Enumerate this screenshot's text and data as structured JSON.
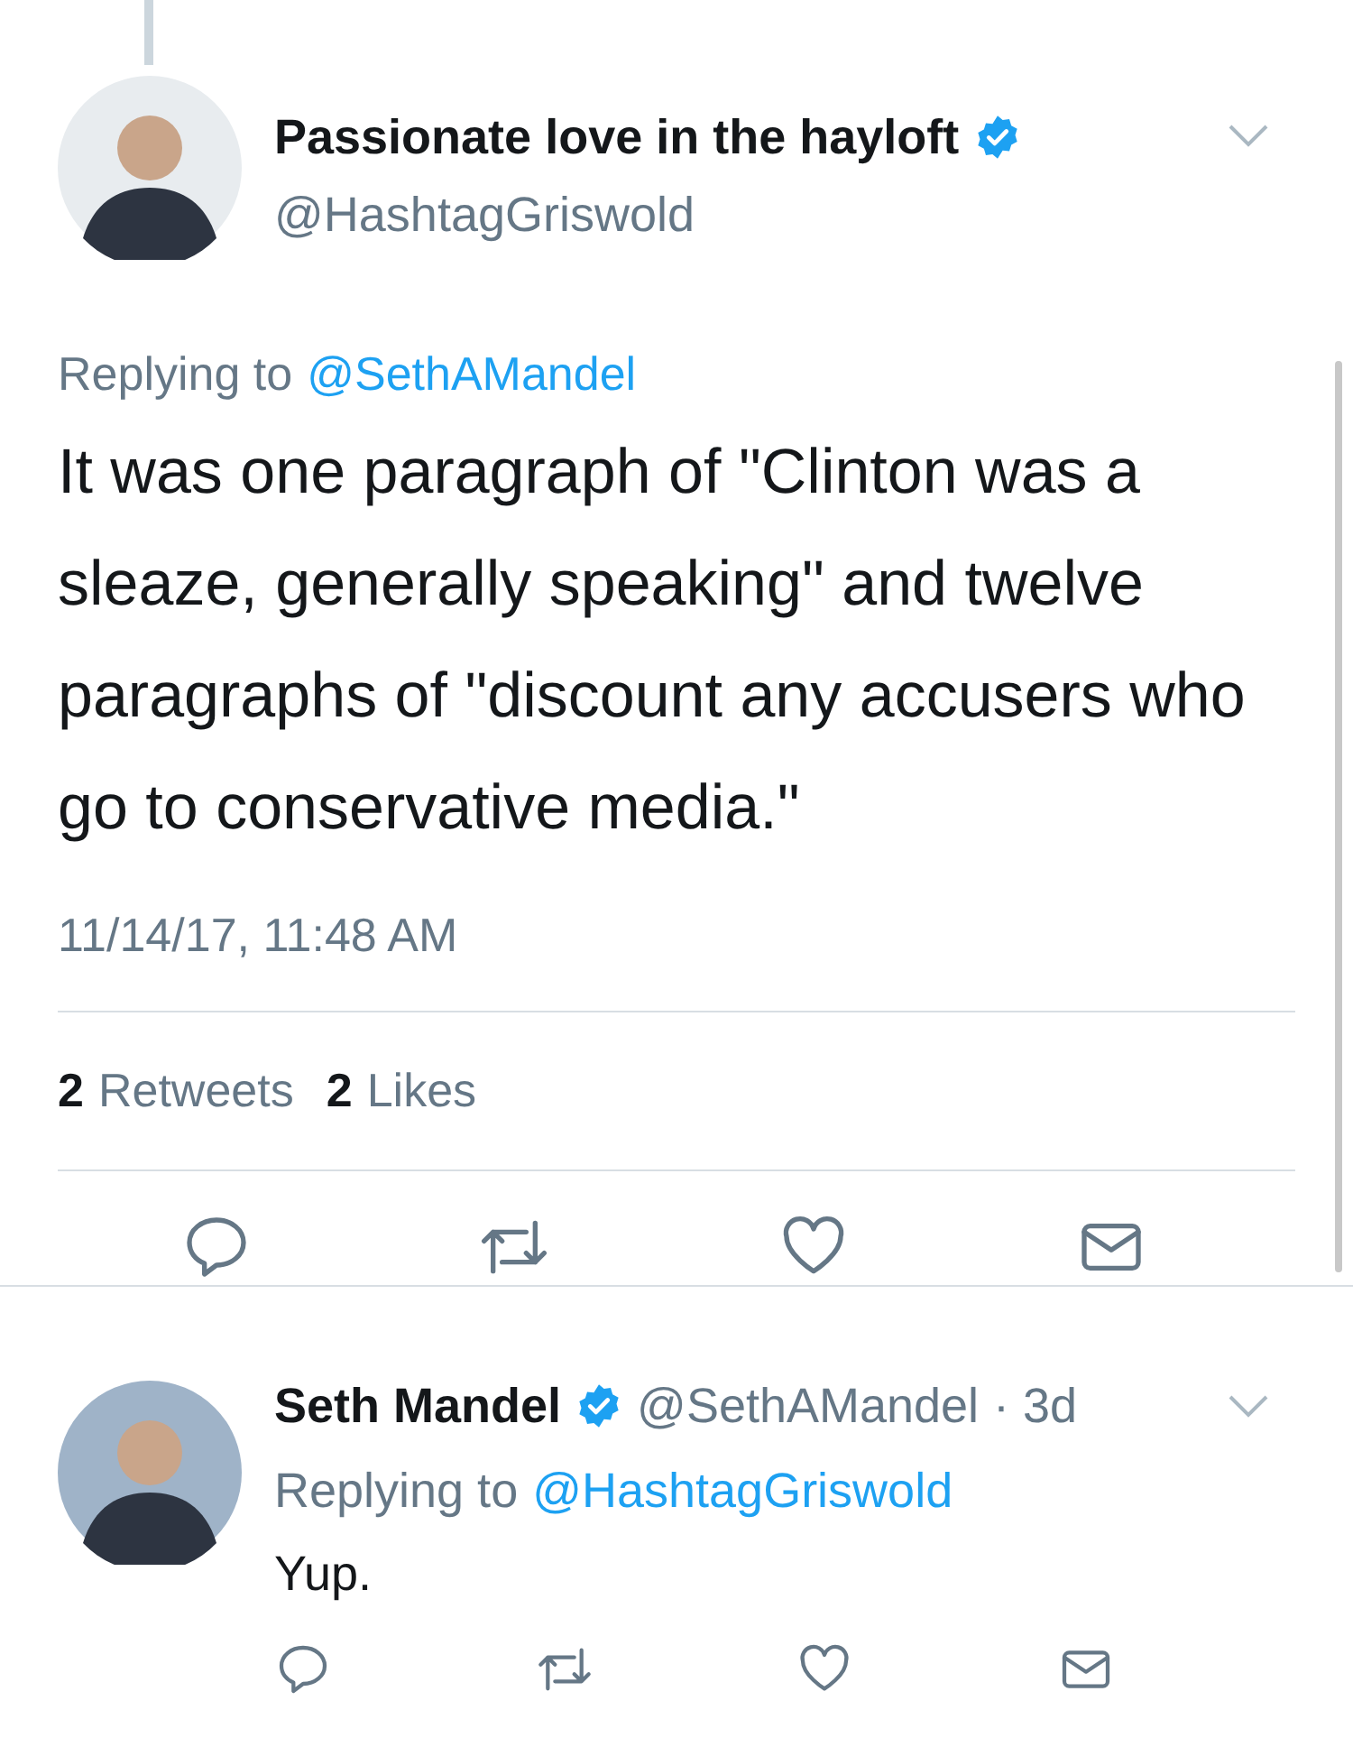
{
  "tweet": {
    "name": "Passionate love in the hayloft",
    "verified": true,
    "handle": "@HashtagGriswold",
    "replying_label": "Replying to",
    "replying_to": "@SethAMandel",
    "text": "It was one paragraph of \"Clinton was a sleaze, generally speaking\" and twelve paragraphs of \"discount any accusers who go to conservative media.\"",
    "timestamp": "11/14/17, 11:48 AM",
    "stats": [
      {
        "count": "2",
        "label": "Retweets"
      },
      {
        "count": "2",
        "label": "Likes"
      }
    ]
  },
  "reply": {
    "name": "Seth Mandel",
    "verified": true,
    "handle": "@SethAMandel",
    "time": "· 3d",
    "replying_label": "Replying to",
    "replying_to": "@HashtagGriswold",
    "text": "Yup."
  }
}
